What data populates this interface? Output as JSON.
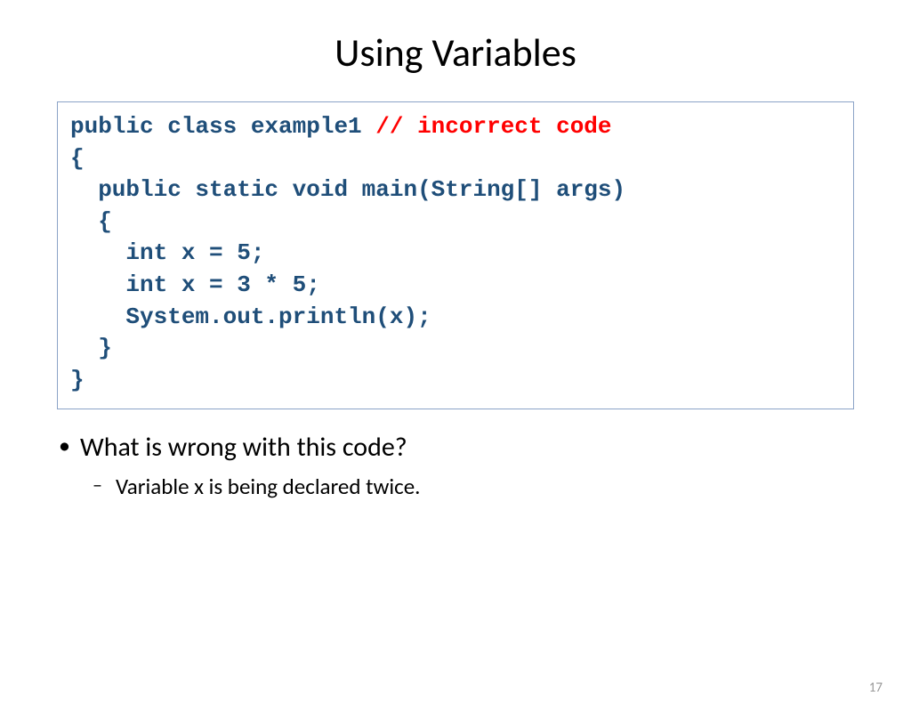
{
  "slide": {
    "title": "Using Variables",
    "code_line1_normal": "public class example1 ",
    "code_line1_comment": "// incorrect code",
    "code_line2": "{",
    "code_line3": "  public static void main(String[] args)",
    "code_line4": "  {",
    "code_line5": "    int x = 5;",
    "code_line6": "    int x = 3 * 5;",
    "code_line7": "    System.out.println(x);",
    "code_line8": "  }",
    "code_line9": "}",
    "question": "What is wrong with this code?",
    "answer": "Variable  x is being declared twice.",
    "page_number": "17"
  }
}
